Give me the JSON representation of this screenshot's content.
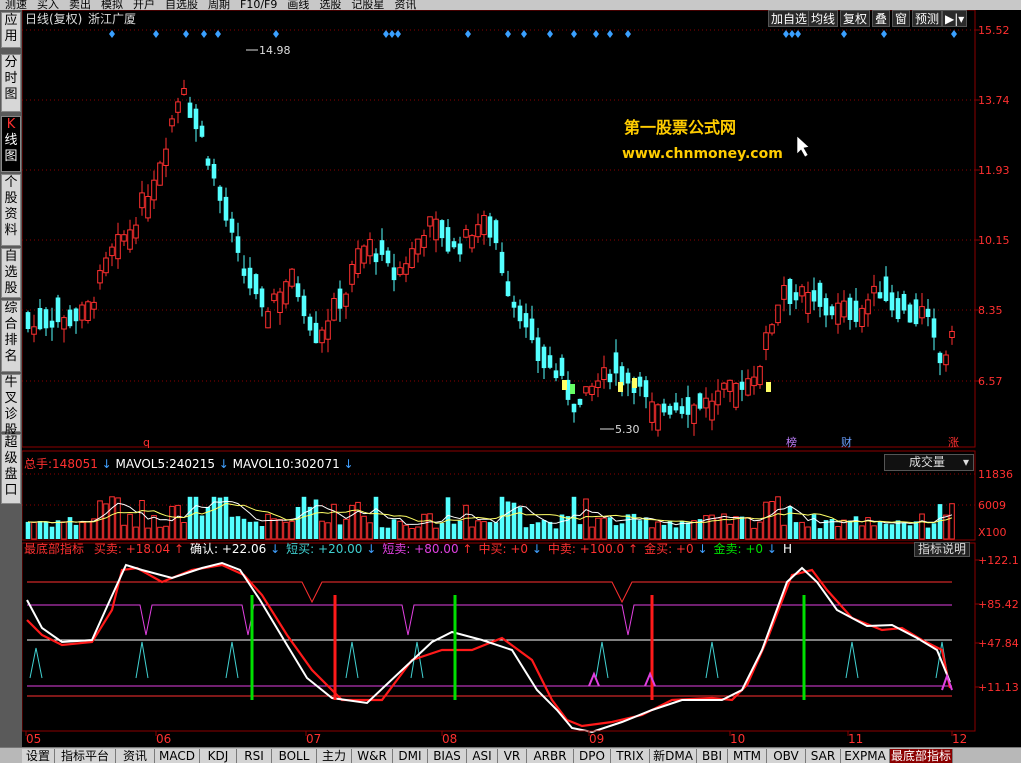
{
  "top_menu": [
    "测速",
    "买入",
    "卖出",
    "模拟",
    "开户",
    "自选股",
    "周期",
    "F10/F9",
    "画线",
    "选股",
    "记股星",
    "资讯"
  ],
  "sidebar": [
    {
      "label": "应用",
      "active": false
    },
    {
      "label": "分时图",
      "active": false
    },
    {
      "label": "K线图",
      "active": true
    },
    {
      "label": "个股资料",
      "active": false
    },
    {
      "label": "自选股",
      "active": false
    },
    {
      "label": "综合排名",
      "active": false
    },
    {
      "label": "牛叉诊股",
      "active": false
    },
    {
      "label": "超级盘口",
      "active": false
    }
  ],
  "header": {
    "period": "日线(复权)",
    "stock_name": "浙江广厦"
  },
  "toolbar": [
    "加自选",
    "均线",
    "复权",
    "叠",
    "窗",
    "预测"
  ],
  "watermark": {
    "line1": "第一股票公式网",
    "line2": "www.chnmoney.com"
  },
  "price_chart": {
    "high_label": "14.98",
    "low_label": "5.30",
    "y_ticks": [
      "15.52",
      "13.74",
      "11.93",
      "10.15",
      "8.35",
      "6.57"
    ],
    "markers": [
      {
        "text": "q",
        "color": "#ff3030"
      },
      {
        "text": "榜",
        "color": "#c080ff"
      },
      {
        "text": "财",
        "color": "#6aa0ff"
      },
      {
        "text": "涨",
        "color": "#ff3030"
      }
    ]
  },
  "volume": {
    "total_label": "总手:",
    "total_value": "148051",
    "ma5_label": "MAVOL5:",
    "ma5_value": "240215",
    "ma10_label": "MAVOL10:",
    "ma10_value": "302071",
    "selector": "成交量",
    "y_ticks": [
      "11836",
      "6009",
      "X100"
    ]
  },
  "indicator": {
    "name": "最底部指标",
    "items": [
      {
        "label": "买卖:",
        "value": "+18.04",
        "color": "#ff3030",
        "arrow": "↑"
      },
      {
        "label": "确认:",
        "value": "+22.06",
        "color": "#ffffff",
        "arrow": "↓"
      },
      {
        "label": "短买:",
        "value": "+20.00",
        "color": "#40d0d0",
        "arrow": "↓"
      },
      {
        "label": "短卖:",
        "value": "+80.00",
        "color": "#e040e0",
        "arrow": "↑"
      },
      {
        "label": "中买:",
        "value": "+0",
        "color": "#ff3030",
        "arrow": "↓"
      },
      {
        "label": "中卖:",
        "value": "+100.0",
        "color": "#ff3030",
        "arrow": "↑"
      },
      {
        "label": "金买:",
        "value": "+0",
        "color": "#ff3030",
        "arrow": "↓"
      },
      {
        "label": "金卖:",
        "value": "+0",
        "color": "#00e000",
        "arrow": "↓"
      }
    ],
    "extra": "H",
    "help": "指标说明",
    "y_ticks": [
      "+122.1",
      "+85.42",
      "+47.84",
      "+11.13"
    ]
  },
  "x_axis": [
    "05",
    "06",
    "07",
    "08",
    "09",
    "10",
    "11",
    "12"
  ],
  "bottom_tabs": [
    {
      "label": "设置",
      "active": false
    },
    {
      "label": "指标平台",
      "active": false
    },
    {
      "label": "资讯",
      "active": false
    },
    {
      "label": "MACD",
      "active": false
    },
    {
      "label": "KDJ",
      "active": false
    },
    {
      "label": "RSI",
      "active": false
    },
    {
      "label": "BOLL",
      "active": false
    },
    {
      "label": "主力",
      "active": false
    },
    {
      "label": "W&R",
      "active": false
    },
    {
      "label": "DMI",
      "active": false
    },
    {
      "label": "BIAS",
      "active": false
    },
    {
      "label": "ASI",
      "active": false
    },
    {
      "label": "VR",
      "active": false
    },
    {
      "label": "ARBR",
      "active": false
    },
    {
      "label": "DPO",
      "active": false
    },
    {
      "label": "TRIX",
      "active": false
    },
    {
      "label": "新DMA",
      "active": false
    },
    {
      "label": "BBI",
      "active": false
    },
    {
      "label": "MTM",
      "active": false
    },
    {
      "label": "OBV",
      "active": false
    },
    {
      "label": "SAR",
      "active": false
    },
    {
      "label": "EXPMA",
      "active": false
    },
    {
      "label": "最底部指标",
      "active": true
    }
  ]
}
